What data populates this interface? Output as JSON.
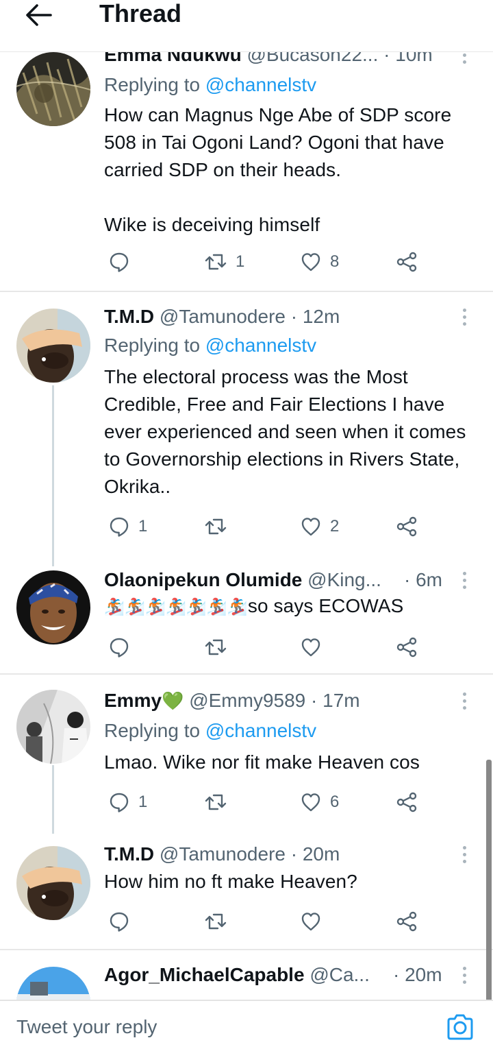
{
  "header": {
    "title": "Thread"
  },
  "tweets": [
    {
      "name": "Emma Ndukwu",
      "handle": "@Bucason22...",
      "dot": "·",
      "time": "10m",
      "replying_label": "Replying to ",
      "replying_to": "@channelstv",
      "text": "How can Magnus Nge Abe of SDP score 508 in Tai Ogoni Land? Ogoni that have carried SDP on their heads.\n\nWike is deceiving himself",
      "reply_count": "",
      "retweet_count": "1",
      "like_count": "8"
    },
    {
      "name": "T.M.D",
      "handle": "@Tamunodere",
      "dot": "·",
      "time": "12m",
      "replying_label": "Replying to ",
      "replying_to": "@channelstv",
      "text": "The electoral process was the Most Credible, Free and Fair Elections I have ever experienced and seen when it comes to Governorship elections in Rivers State, Okrika..",
      "reply_count": "1",
      "retweet_count": "",
      "like_count": "2"
    },
    {
      "name": "Olaonipekun Olumide",
      "handle": "@King...",
      "dot": "·",
      "time": "6m",
      "emoji": "🏂🏂🏂🏂🏂🏂🏂",
      "text": "so says ECOWAS",
      "reply_count": "",
      "retweet_count": "",
      "like_count": ""
    },
    {
      "name": "Emmy",
      "name_emoji": "💚",
      "handle": "@Emmy9589",
      "dot": "·",
      "time": "17m",
      "replying_label": "Replying to ",
      "replying_to": "@channelstv",
      "text": "Lmao. Wike nor fit make Heaven cos",
      "reply_count": "1",
      "retweet_count": "",
      "like_count": "6"
    },
    {
      "name": "T.M.D",
      "handle": "@Tamunodere",
      "dot": "·",
      "time": "20m",
      "text": "How him no ft make Heaven?",
      "reply_count": "",
      "retweet_count": "",
      "like_count": ""
    },
    {
      "name": "Agor_MichaelCapable",
      "handle": "@Ca...",
      "dot": "·",
      "time": "20m"
    }
  ],
  "composer": {
    "placeholder": "Tweet your reply"
  },
  "icons": {
    "back": "arrow-left-icon",
    "reply": "reply-bubble-icon",
    "retweet": "retweet-icon",
    "like": "heart-icon",
    "share": "share-icon",
    "more": "more-vertical-icon",
    "camera": "camera-icon"
  },
  "colors": {
    "accent": "#1d9bf0",
    "secondary_text": "#536471",
    "primary_text": "#0f1419",
    "thread_line": "#cfd9de",
    "heart_emoji": "#3dae2b"
  }
}
